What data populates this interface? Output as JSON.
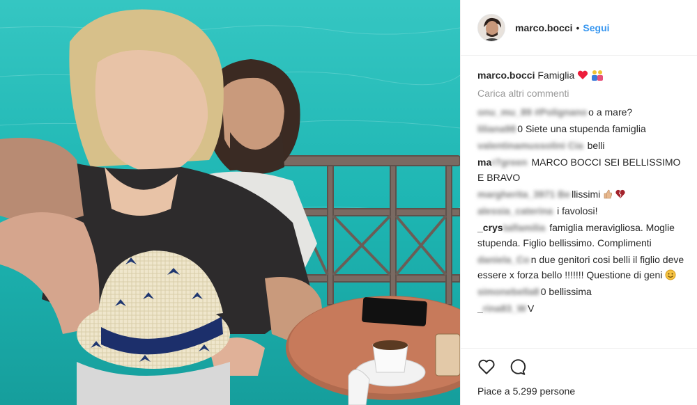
{
  "post": {
    "author": "marco.bocci",
    "follow_label": "Segui",
    "separator": "•",
    "caption_user": "marco.bocci",
    "caption_text": "Famiglia",
    "load_more": "Carica altri commenti",
    "likes": "Piace a 5.299 persone"
  },
  "comments": [
    {
      "user": "onu_mu_89 #Polignano",
      "text": "o a mare?"
    },
    {
      "user": "liliana98",
      "text": "0 Siete una stupenda famiglia"
    },
    {
      "user": "valentinamussolini Cia",
      "text": "belli"
    },
    {
      "user_visible": "ma",
      "user": "r7green",
      "text": "MARCO BOCCI SEI BELLISSIMO E BRAVO"
    },
    {
      "user": "margherita_3971 Be",
      "text": "llissimi"
    },
    {
      "user": "alessia_caterina",
      "text": "i favolosi!"
    },
    {
      "user_visible": "_crys",
      "user": "talfamilia",
      "text": "famiglia meravigliosa. Moglie stupenda. Figlio bellissimo. Complimenti"
    },
    {
      "user": "daniela_Co",
      "text": "n due genitori cosi belli il figlio deve essere x forza bello !!!!!!! Questione di geni"
    },
    {
      "user": "simonebella8",
      "text": "0 bellissima"
    },
    {
      "user_visible": "_",
      "user": "rina83_W",
      "text": "V"
    }
  ],
  "icons": {
    "like": "heart-outline-icon",
    "comment": "comment-bubble-icon"
  },
  "colors": {
    "follow": "#3897f0",
    "heart": "#ed1d3b",
    "muted": "#999999"
  }
}
